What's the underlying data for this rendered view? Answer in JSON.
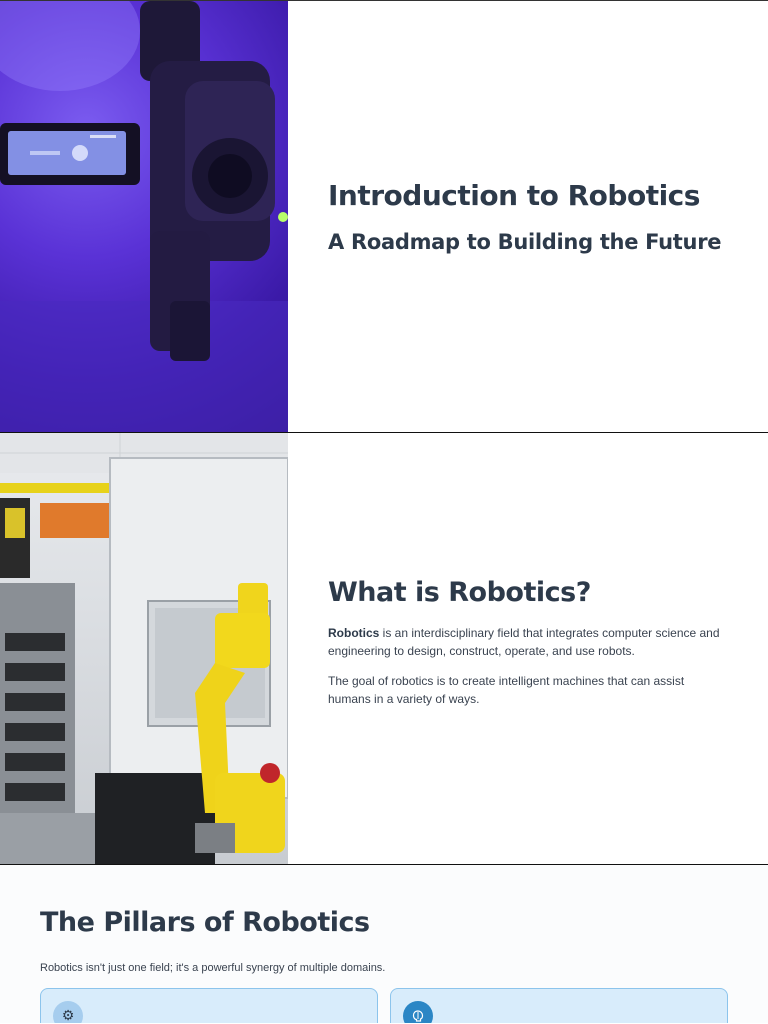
{
  "slide1": {
    "title": "Introduction to Robotics",
    "subtitle": "A Roadmap to Building the Future"
  },
  "slide2": {
    "title": "What is Robotics?",
    "para1_strong": "Robotics",
    "para1_rest": " is an interdisciplinary field that integrates computer science and engineering to design, construct, operate, and use robots.",
    "para2": "The goal of robotics is to create intelligent machines that can assist humans in a variety of ways."
  },
  "pillars": {
    "title": "The Pillars of Robotics",
    "subtitle": "Robotics isn't just one field; it's a powerful synergy of multiple domains.",
    "cards": [
      {
        "icon": "gear-icon"
      },
      {
        "icon": "brain-icon"
      }
    ]
  },
  "colors": {
    "heading": "#2d3a4a",
    "card_bg": "#d8ecfb",
    "card_border": "#8cc4ec",
    "accent_blue": "#2b86c5"
  }
}
